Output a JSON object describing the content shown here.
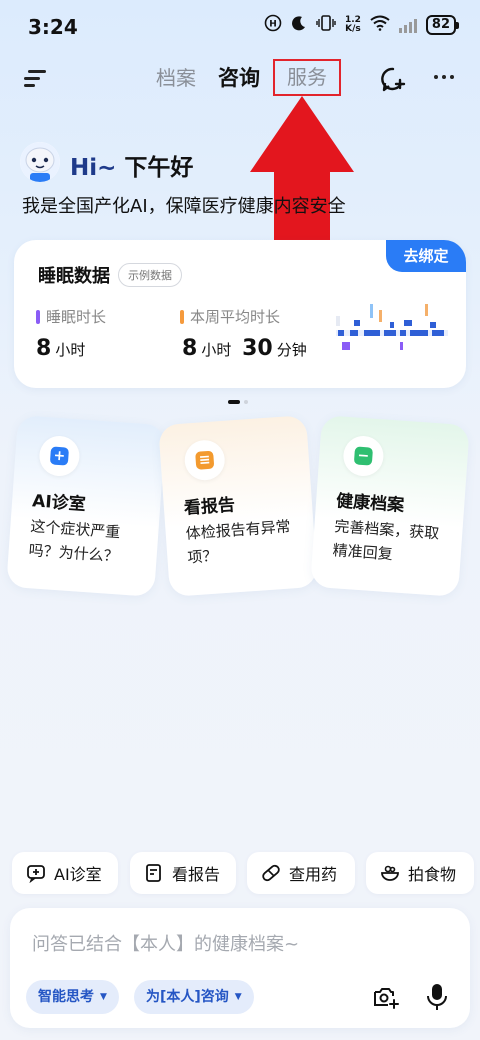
{
  "status_bar": {
    "time": "3:24",
    "net_speed_top": "1.2",
    "net_speed_bottom": "K/s",
    "battery": "82"
  },
  "nav": {
    "tabs": [
      {
        "label": "档案"
      },
      {
        "label": "咨询"
      },
      {
        "label": "服务"
      }
    ],
    "active_tab": "咨询"
  },
  "greeting": {
    "hi": "Hi~",
    "text": "下午好",
    "intro": "我是全国产化AI，保障医疗健康内容安全"
  },
  "sleep_card": {
    "title": "睡眠数据",
    "badge": "示例数据",
    "bind_button": "去绑定",
    "metrics": [
      {
        "label": "睡眠时长",
        "value": "8",
        "unit": "小时",
        "color": "#8a5cf6"
      },
      {
        "label": "本周平均时长",
        "value_h": "8",
        "unit_h": "小时",
        "value_m": "30",
        "unit_m": "分钟",
        "color": "#f59a3c"
      }
    ]
  },
  "feature_cards": [
    {
      "title": "AI诊室",
      "desc": "这个症状严重吗？为什么？",
      "icon": "chat-plus-icon",
      "color": "#2a7cf6"
    },
    {
      "title": "看报告",
      "desc": "体检报告有异常项？",
      "icon": "report-icon",
      "color": "#f39a2e"
    },
    {
      "title": "健康档案",
      "desc": "完善档案，获取精准回复",
      "icon": "folder-icon",
      "color": "#2fbf71"
    }
  ],
  "quick_actions": [
    {
      "label": "AI诊室",
      "icon": "chat-plus-icon"
    },
    {
      "label": "看报告",
      "icon": "report-icon"
    },
    {
      "label": "查用药",
      "icon": "pill-icon"
    },
    {
      "label": "拍食物",
      "icon": "food-bowl-icon"
    }
  ],
  "input": {
    "placeholder": "问答已结合【本人】的健康档案~",
    "mode_pill": "智能思考",
    "profile_pill": "为[本人]咨询"
  },
  "colors": {
    "accent": "#2a7cf6",
    "highlight_box": "#e2242c",
    "arrow": "#e3161e"
  }
}
